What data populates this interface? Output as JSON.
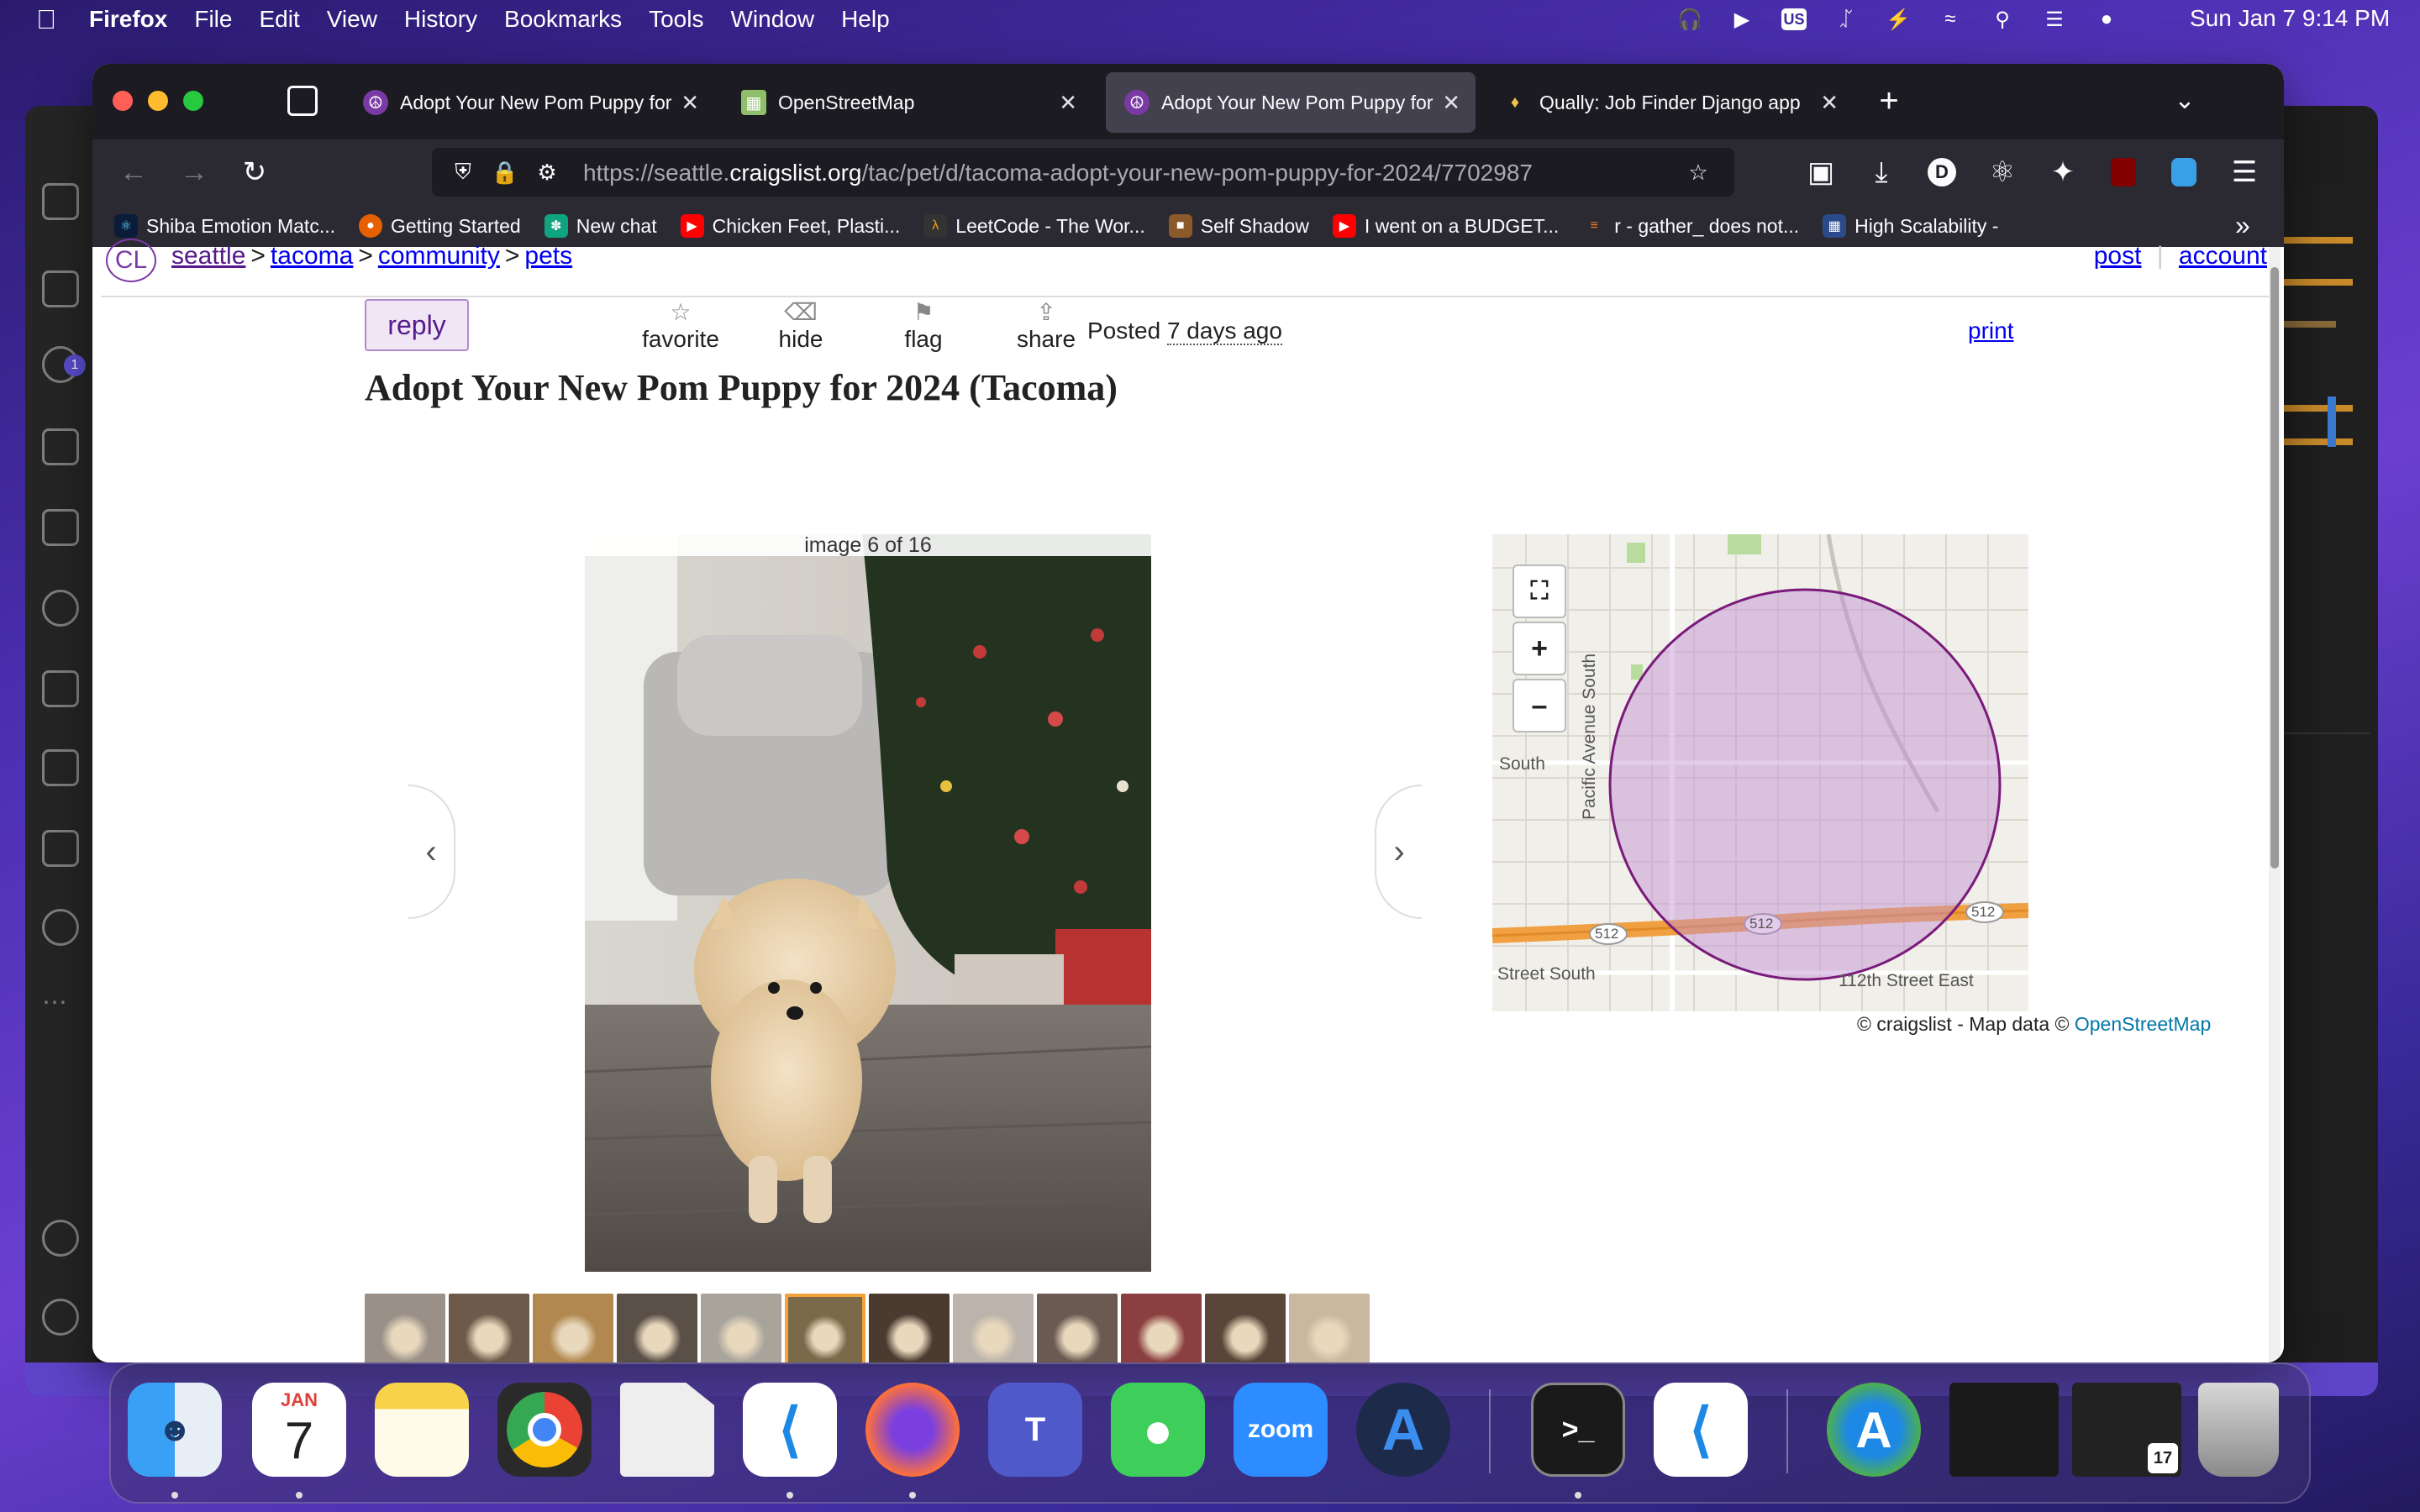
{
  "menubar": {
    "app_name": "Firefox",
    "menus": [
      "File",
      "Edit",
      "View",
      "History",
      "Bookmarks",
      "Tools",
      "Window",
      "Help"
    ],
    "input_source": "US",
    "clock": "Sun Jan 7  9:14 PM"
  },
  "editor_window": {
    "scm_badge": "1"
  },
  "browser": {
    "tabs": [
      {
        "title": "Adopt Your New Pom Puppy for 2024 (Tacoma)",
        "active": false,
        "icon": "peace-icon"
      },
      {
        "title": "OpenStreetMap",
        "active": false,
        "icon": "osm-icon"
      },
      {
        "title": "Adopt Your New Pom Puppy for 2024 (Tacoma)",
        "active": true,
        "icon": "peace-icon"
      },
      {
        "title": "Qually: Job Finder Django app",
        "active": false,
        "icon": "qually-icon"
      }
    ],
    "url_host_prefix": "https://seattle.",
    "url_host": "craigslist.org",
    "url_path": "/tac/pet/d/tacoma-adopt-your-new-pom-puppy-for-2024/7702987",
    "profile_initial": "D",
    "bookmarks": [
      {
        "label": "Shiba Emotion Matc...",
        "color": "#0b1c3a"
      },
      {
        "label": "Getting Started",
        "color": "#e66000"
      },
      {
        "label": "New chat",
        "color": "#10a37f"
      },
      {
        "label": "Chicken Feet, Plasti...",
        "color": "#ff0000"
      },
      {
        "label": "LeetCode - The Wor...",
        "color": "#333333"
      },
      {
        "label": "Self Shadow",
        "color": "#8a5a2a"
      },
      {
        "label": "I went on a BUDGET...",
        "color": "#ff0000"
      },
      {
        "label": "r - gather_ does not...",
        "color": "#f48024"
      },
      {
        "label": "High Scalability -",
        "color": "#2a4a8a"
      }
    ]
  },
  "page": {
    "logo": "CL",
    "breadcrumbs": [
      "seattle",
      "tacoma",
      "community",
      "pets"
    ],
    "breadcrumb_sep": ">",
    "links_right": [
      "post",
      "account"
    ],
    "reply": "reply",
    "actions": [
      {
        "label": "favorite",
        "icon": "star-icon"
      },
      {
        "label": "hide",
        "icon": "trash-icon"
      },
      {
        "label": "flag",
        "icon": "flag-icon"
      },
      {
        "label": "share",
        "icon": "share-icon"
      }
    ],
    "posted_label": "Posted",
    "posted_time": "7 days ago",
    "print": "print",
    "title": "Adopt Your New Pom Puppy for 2024 (Tacoma)",
    "image_counter": "image 6 of 16",
    "thumbnails_total": 16,
    "selected_thumbnail": 6,
    "map": {
      "labels": [
        "South",
        "Pacific Avenue South",
        "Street South",
        "112th Street East"
      ],
      "route_shield": "512",
      "attribution_text": "© craigslist - Map data ©",
      "attribution_link": "OpenStreetMap"
    }
  },
  "dock": {
    "calendar_month": "JAN",
    "calendar_day": "7",
    "zoom_label": "zoom",
    "mini_calendar_day": "17"
  }
}
